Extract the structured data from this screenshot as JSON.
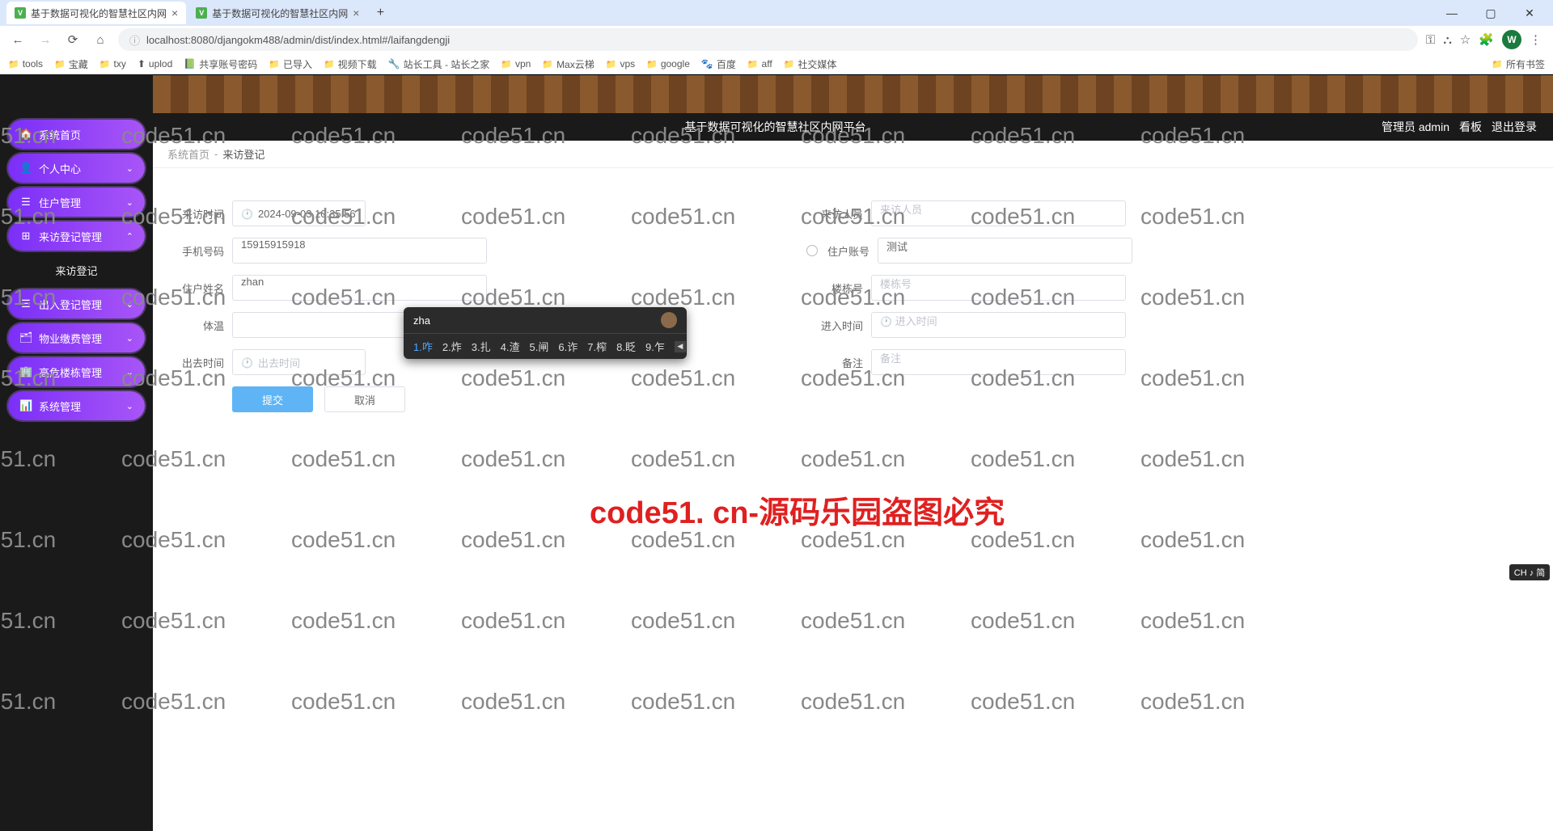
{
  "browser": {
    "tabs": [
      {
        "title": "基于数据可视化的智慧社区内网",
        "active": true
      },
      {
        "title": "基于数据可视化的智慧社区内网",
        "active": false
      }
    ],
    "url": "localhost:8080/djangokm488/admin/dist/index.html#/laifangdengji",
    "avatar_letter": "W",
    "bookmarks": [
      "tools",
      "宝藏",
      "txy",
      "uplod",
      "共享账号密码",
      "已导入",
      "视频下载",
      "站长工具 - 站长之家",
      "vpn",
      "Max云梯",
      "vps",
      "google",
      "百度",
      "aff",
      "社交媒体"
    ],
    "bookmarks_right": "所有书签"
  },
  "header": {
    "title": "基于数据可视化的智慧社区内网平台",
    "user_label": "管理员 admin",
    "kanban": "看板",
    "logout": "退出登录"
  },
  "sidebar": {
    "items": [
      {
        "icon": "🏠",
        "label": "系统首页",
        "chev": ""
      },
      {
        "icon": "👤",
        "label": "个人中心",
        "chev": "⌄"
      },
      {
        "icon": "☰",
        "label": "住户管理",
        "chev": "⌄"
      },
      {
        "icon": "⊞",
        "label": "来访登记管理",
        "chev": "⌃",
        "expanded": true
      },
      {
        "icon": "☰",
        "label": "出入登记管理",
        "chev": "⌄"
      },
      {
        "icon": "🗂",
        "label": "物业缴费管理",
        "chev": "⌄"
      },
      {
        "icon": "🏢",
        "label": "高危楼栋管理",
        "chev": "⌄"
      },
      {
        "icon": "📊",
        "label": "系统管理",
        "chev": "⌄"
      }
    ],
    "sub_item": "来访登记"
  },
  "breadcrumb": {
    "root": "系统首页",
    "sep": "-",
    "current": "来访登记"
  },
  "form": {
    "visit_time_label": "来访时间",
    "visit_time_value": "2024-09-03 10:35:56",
    "visitor_label": "来访人员",
    "visitor_ph": "来访人员",
    "phone_label": "手机号码",
    "phone_value": "15915915918",
    "account_label": "住户账号",
    "account_value": "测试",
    "name_label": "住户姓名",
    "name_value": "zhan",
    "building_label": "楼栋号",
    "building_ph": "楼栋号",
    "temp_label": "体温",
    "temp_ph": "",
    "entry_label": "进入时间",
    "entry_ph": "进入时间",
    "exit_label": "出去时间",
    "exit_ph": "出去时间",
    "remark_label": "备注",
    "remark_ph": "备注",
    "submit": "提交",
    "cancel": "取消"
  },
  "ime": {
    "input": "zha",
    "candidates": [
      {
        "n": "1",
        "w": "咋",
        "sel": true
      },
      {
        "n": "2",
        "w": "炸"
      },
      {
        "n": "3",
        "w": "扎"
      },
      {
        "n": "4",
        "w": "渣"
      },
      {
        "n": "5",
        "w": "闸"
      },
      {
        "n": "6",
        "w": "诈"
      },
      {
        "n": "7",
        "w": "榨"
      },
      {
        "n": "8",
        "w": "眨"
      },
      {
        "n": "9",
        "w": "乍"
      }
    ],
    "indicator": "CH ♪ 简"
  },
  "watermark_single": "code51.cn",
  "big_watermark": "code51. cn-源码乐园盗图必究"
}
